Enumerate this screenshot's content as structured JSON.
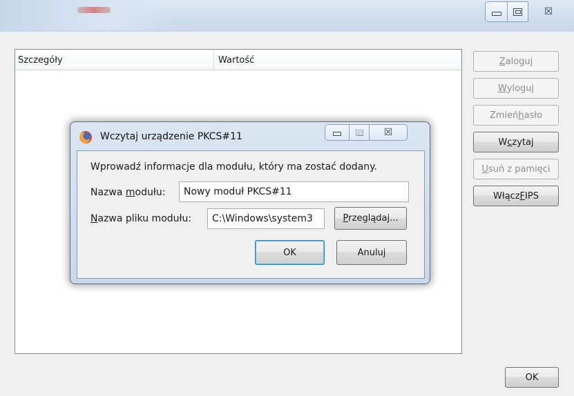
{
  "window": {
    "caption_icons": [
      "minimize-icon",
      "maximize-icon",
      "close-icon"
    ]
  },
  "table": {
    "columns": [
      "Szczegóły",
      "Wartość"
    ],
    "rows": []
  },
  "side_buttons": [
    {
      "label_pre": "",
      "label_u": "Z",
      "label_post": "aloguj",
      "enabled": false
    },
    {
      "label_pre": "",
      "label_u": "W",
      "label_post": "yloguj",
      "enabled": false
    },
    {
      "label_pre": "Zmień ",
      "label_u": "h",
      "label_post": "asło",
      "enabled": false
    },
    {
      "label_pre": "W",
      "label_u": "c",
      "label_post": "zytaj",
      "enabled": true
    },
    {
      "label_pre": "",
      "label_u": "U",
      "label_post": "suń z pamięci",
      "enabled": false
    },
    {
      "label_pre": "Włącz ",
      "label_u": "F",
      "label_post": "IPS",
      "enabled": true
    }
  ],
  "ok_button": "OK",
  "dialog": {
    "title": "Wczytaj urządzenie PKCS#11",
    "intro": "Wprowadź informacje dla modułu, który ma zostać dodany.",
    "module_name_label_pre": "Nazwa ",
    "module_name_label_u": "m",
    "module_name_label_post": "odułu:",
    "module_name_value": "Nowy moduł PKCS#11",
    "module_file_label_pre": "",
    "module_file_label_u": "N",
    "module_file_label_post": "azwa pliku modułu:",
    "module_file_value": "C:\\Windows\\system3",
    "browse_pre": "",
    "browse_u": "P",
    "browse_post": "rzeglądaj...",
    "ok_label": "OK",
    "cancel_label": "Anuluj"
  }
}
